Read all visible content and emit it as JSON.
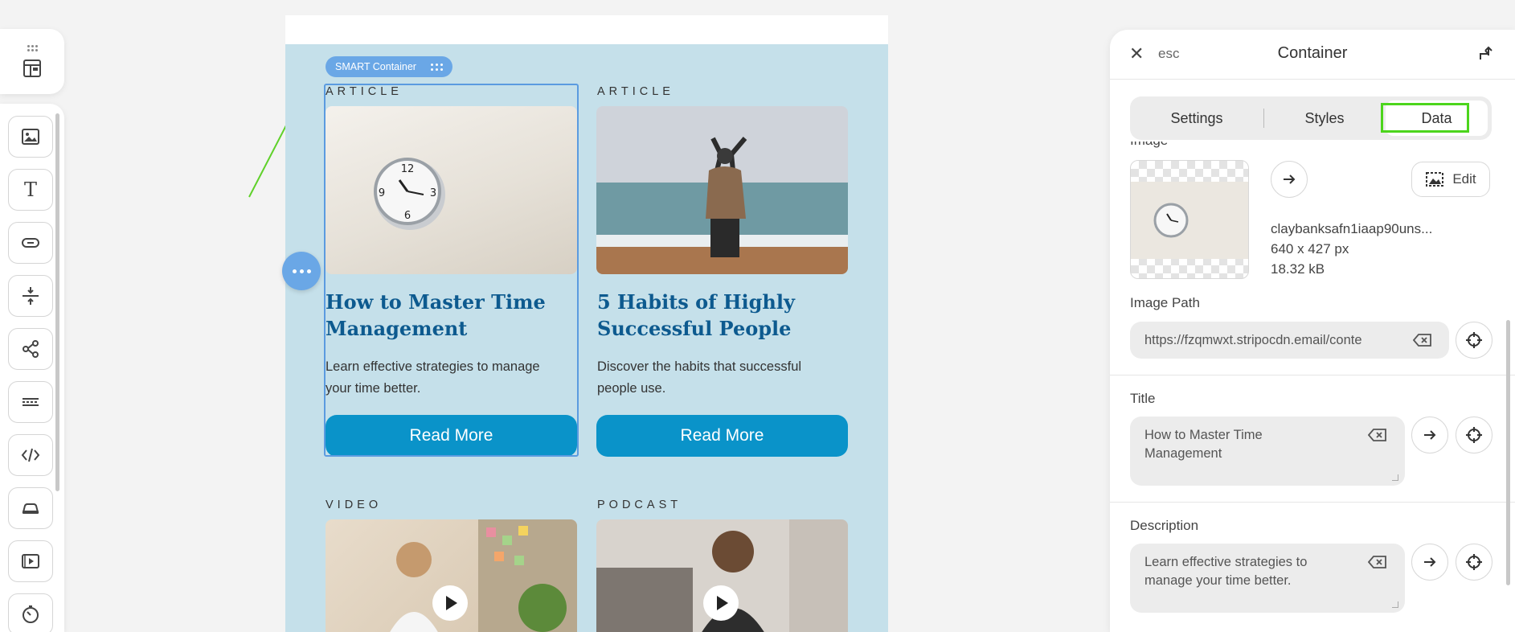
{
  "toolbar": {
    "items": [
      "layout-icon",
      "image-icon",
      "text-icon",
      "button-icon",
      "spacer-icon",
      "social-icon",
      "divider-icon",
      "html-icon",
      "menu-icon",
      "video-icon",
      "timer-icon"
    ],
    "text_label": "T"
  },
  "canvas": {
    "smart_tag": "SMART Container",
    "cards": [
      {
        "kicker": "ARTICLE",
        "title_line1": "How to Master Time",
        "title_line2": "Management",
        "desc_line1": "Learn effective strategies to manage",
        "desc_line2": "your time better.",
        "button": "Read More"
      },
      {
        "kicker": "ARTICLE",
        "title_line1": "5 Habits of Highly",
        "title_line2": "Successful People",
        "desc_line1": "Discover the habits that successful",
        "desc_line2": "people use.",
        "button": "Read More"
      },
      {
        "kicker": "VIDEO"
      },
      {
        "kicker": "PODCAST"
      }
    ]
  },
  "panel": {
    "close_label": "esc",
    "title": "Container",
    "tabs": [
      "Settings",
      "Styles",
      "Data"
    ],
    "active_tab": "Data",
    "image_label": "Image",
    "edit_label": "Edit",
    "file_name": "claybanksafn1iaap90uns...",
    "dimensions": "640 x 427 px",
    "file_size": "18.32 kB",
    "image_path_label": "Image Path",
    "image_path_value": "https://fzqmwxt.stripocdn.email/conte",
    "title_label": "Title",
    "title_value_line1": "How to Master Time",
    "title_value_line2": "Management",
    "description_label": "Description",
    "description_value_line1": "Learn effective strategies to",
    "description_value_line2": "manage your time better."
  },
  "colors": {
    "accent": "#6aa7e6",
    "button": "#0a93c9",
    "title": "#0d5a8f",
    "canvas_bg": "#c5e0ea",
    "highlight": "#4cd51c"
  }
}
